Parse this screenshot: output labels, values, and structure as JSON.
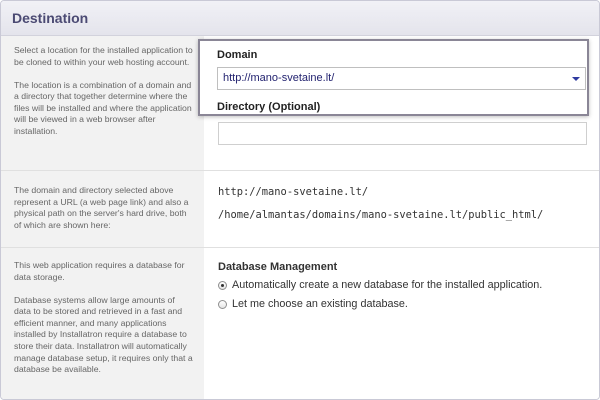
{
  "header": {
    "title": "Destination"
  },
  "destination": {
    "help": [
      "Select a location for the installed application to be cloned to within your web hosting account.",
      "The location is a combination of a domain and a directory that together determine where the files will be installed and where the application will be viewed in a web browser after installation."
    ],
    "domain_label": "Domain",
    "domain_value": "http://mano-svetaine.lt/",
    "directory_label": "Directory (Optional)",
    "directory_value": ""
  },
  "paths": {
    "help": [
      "The domain and directory selected above represent a URL (a web page link) and also a physical path on the server's hard drive, both of which are shown here:"
    ],
    "url": "http://mano-svetaine.lt/",
    "physical_path": "/home/almantas/domains/mano-svetaine.lt/public_html/"
  },
  "database": {
    "help": [
      "This web application requires a database for data storage.",
      "Database systems allow large amounts of data to be stored and retrieved in a fast and efficient manner, and many applications installed by Installatron require a database to store their data. Installatron will automatically manage database setup, it requires only that a database be available."
    ],
    "heading": "Database Management",
    "options": [
      {
        "label": "Automatically create a new database for the installed application.",
        "checked": true
      },
      {
        "label": "Let me choose an existing database.",
        "checked": false
      }
    ]
  }
}
